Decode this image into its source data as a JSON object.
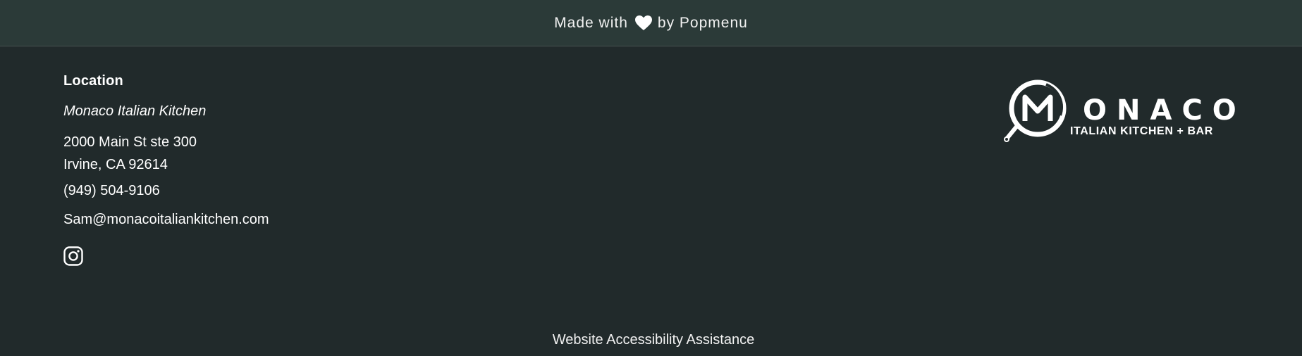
{
  "top_bar": {
    "made_with": "Made with",
    "by": "by Popmenu",
    "icon": "heart-icon"
  },
  "location": {
    "heading": "Location",
    "name": "Monaco Italian Kitchen",
    "address_line1": "2000 Main St ste 300",
    "address_line2": "Irvine, CA 92614",
    "phone": "(949) 504-9106",
    "email": "Sam@monacoitaliankitchen.com",
    "social_icon": "instagram-icon"
  },
  "logo": {
    "word": "ONACO",
    "tagline": "ITALIAN KITCHEN + BAR",
    "mark_letter": "M"
  },
  "footer": {
    "accessibility": "Website Accessibility Assistance"
  },
  "colors": {
    "background": "#212a2b",
    "top_bar": "#2b3a38",
    "text": "#ffffff"
  }
}
